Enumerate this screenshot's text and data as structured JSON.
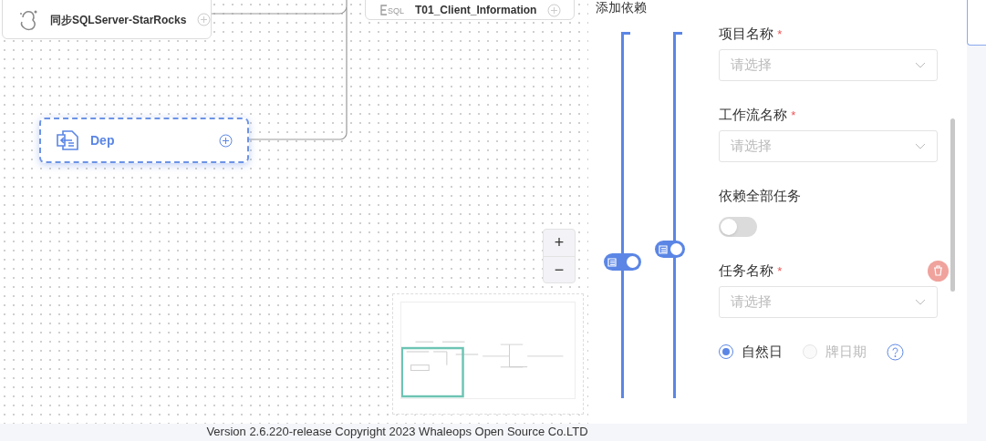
{
  "canvas": {
    "nodes": [
      {
        "label": "同步SQLServer-StarRocks",
        "kind": "sync",
        "selected": false
      },
      {
        "label": "T01_Client_Information",
        "kind": "sql",
        "icon_text": "SQL",
        "selected": false
      },
      {
        "label": "Dep",
        "kind": "dependent",
        "selected": true
      }
    ],
    "zoom_controls": [
      "+",
      "−"
    ]
  },
  "panel": {
    "title": "添加依赖",
    "fields": [
      {
        "kind": "select",
        "label": "项目名称",
        "required_mark": "*",
        "placeholder": "请选择"
      },
      {
        "kind": "select",
        "label": "工作流名称",
        "required_mark": "*",
        "placeholder": "请选择"
      },
      {
        "kind": "switch",
        "label": "依赖全部任务",
        "on": false
      },
      {
        "kind": "select",
        "label": "任务名称",
        "required_mark": "*",
        "placeholder": "请选择",
        "deletable": true
      },
      {
        "kind": "radio",
        "options": [
          {
            "label": "自然日",
            "selected": true,
            "disabled": false
          },
          {
            "label": "牌日期",
            "selected": false,
            "disabled": true
          }
        ]
      }
    ]
  },
  "footer": "Version 2.6.220-release  Copyright 2023 Whaleops Open Source Co.LTD"
}
